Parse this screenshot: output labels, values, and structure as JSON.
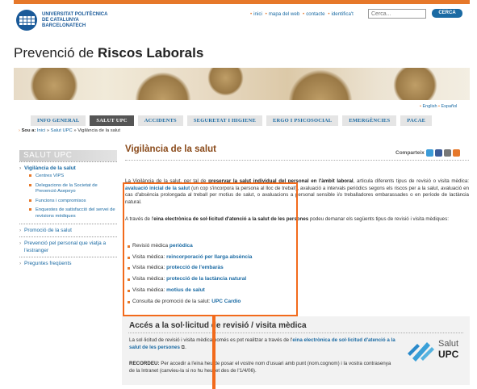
{
  "header": {
    "logo_line1": "UNIVERSITAT POLITÈCNICA",
    "logo_line2": "DE CATALUNYA",
    "logo_line3": "BARCELONATECH",
    "links": [
      "inici",
      "mapa del web",
      "contacte",
      "identifica't"
    ],
    "search_placeholder": "Cerca...",
    "search_button": "CERCA"
  },
  "site_title_pre": "Prevenció de ",
  "site_title_bold": "Riscos Laborals",
  "lang": {
    "english": "English",
    "espanol": "Español"
  },
  "nav": [
    "INFO GENERAL",
    "SALUT UPC",
    "ACCIDENTS",
    "SEGURETAT I HIGIENE",
    "ERGO I PSICOSOCIAL",
    "EMERGÈNCIES",
    "PACAE"
  ],
  "breadcrumb": {
    "label": "Sou a:",
    "items": [
      "Inici",
      "Salut UPC",
      "Vigilància de la salut"
    ]
  },
  "sidebar": {
    "heading": "SALUT UPC",
    "active": "Vigilància de la salut",
    "subitems": [
      "Centres VIPS",
      "Delegacions de la Societat de Prevenció Asepeyo",
      "Funcions i compromisos",
      "Enquestes de satisfacció del servei de revisions mèdiques"
    ],
    "others": [
      "Promoció de la salut",
      "Prevenció pel personal que viatja a l'estranger",
      "Preguntes freqüents"
    ]
  },
  "main": {
    "title": "Vigilància de la salut",
    "share_label": "Comparteix",
    "p1_a": "La Vigilància de la salut, per tal de ",
    "p1_b": "preservar la salut individual del personal en l'àmbit laboral",
    "p1_c": ", articula diferents tipus de revisió o visita mèdica: ",
    "p1_link": "avaluació inicial de la salut",
    "p1_d": " (un cop s'incorpora la persona al lloc de treball), avaluació a intervals periòdics segons els riscos per a la salut, avaluació en cas d'absència prolongada al treball per motius de salut, o avaluacions a personal sensible i/o treballadores embarassades o en període de lactància natural.",
    "p2_a": "A través de l'",
    "p2_b": "eina electrònica de sol·licitud d'atenció a la salut de les persones",
    "p2_c": " podeu demanar els següents tipus de revisió i visita mèdiques:",
    "list": [
      {
        "pre": "Revisió mèdica ",
        "link": "periòdica"
      },
      {
        "pre": "Visita mèdica: ",
        "link": "reincorporació per llarga absència"
      },
      {
        "pre": "Visita mèdica: ",
        "link": "protecció de l'embaràs"
      },
      {
        "pre": "Visita mèdica: ",
        "link": "protecció de la lactància natural"
      },
      {
        "pre": "Visita mèdica: ",
        "link": "motius de salut"
      },
      {
        "pre": "Consulta de promoció de la salut: ",
        "link": "UPC Cardio"
      }
    ]
  },
  "card": {
    "title": "Accés a la sol·licitud de revisió / visita mèdica",
    "p1_a": "La sol·licitud de revisió i visita mèdica només es pot realitzar a través de l'",
    "p1_link": "eina electrònica de sol·licitud d'atenció a la salut de les persones",
    "p1_b": ".",
    "p2_label": "RECORDEU:",
    "p2_text": " Per accedir a l'eina heu de posar el vostre nom d'usuari amb punt (nom.cognom) i la vostra contrasenya de la Intranet (canvieu-la si no hu heu fet des de l'1/4/06).",
    "logo_line1": "Salut",
    "logo_line2": "UPC"
  },
  "colors": {
    "accent": "#e6782a",
    "link": "#1a6aa3",
    "title": "#8a4a1a",
    "highlight": "#f26a1b"
  }
}
